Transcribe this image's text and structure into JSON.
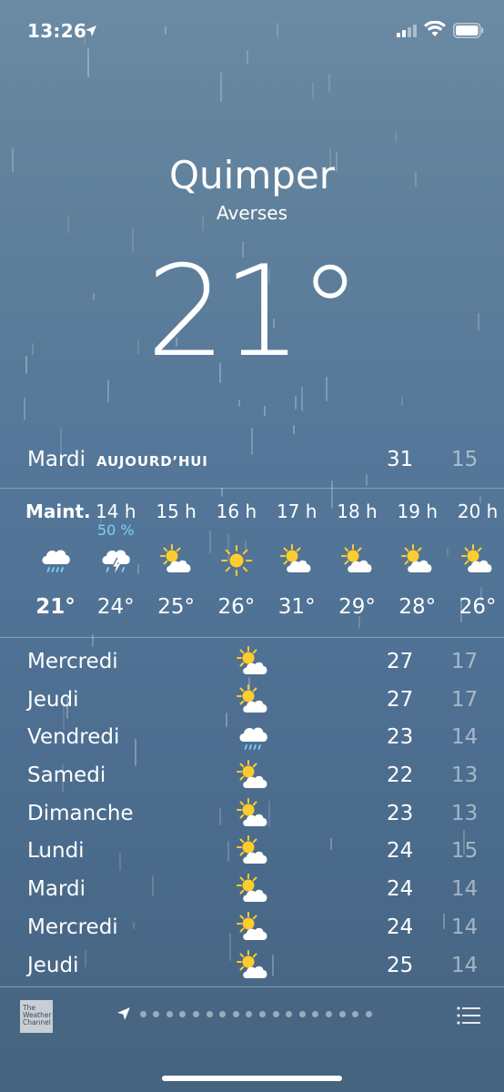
{
  "status_bar": {
    "time": "13:26"
  },
  "header": {
    "city": "Quimper",
    "condition": "Averses",
    "temperature": "21°"
  },
  "today": {
    "day": "Mardi",
    "tag": "AUJOURD’HUI",
    "high": "31",
    "low": "15"
  },
  "hourly": [
    {
      "hour": "Maint.",
      "precip": "",
      "icon": "rain-cloud-icon",
      "temp": "21°"
    },
    {
      "hour": "14 h",
      "precip": "50 %",
      "icon": "thunderstorm-icon",
      "temp": "24°"
    },
    {
      "hour": "15 h",
      "precip": "",
      "icon": "partly-sunny-icon",
      "temp": "25°"
    },
    {
      "hour": "16 h",
      "precip": "",
      "icon": "sun-icon",
      "temp": "26°"
    },
    {
      "hour": "17 h",
      "precip": "",
      "icon": "partly-sunny-icon",
      "temp": "31°"
    },
    {
      "hour": "18 h",
      "precip": "",
      "icon": "partly-sunny-icon",
      "temp": "29°"
    },
    {
      "hour": "19 h",
      "precip": "",
      "icon": "partly-sunny-icon",
      "temp": "28°"
    },
    {
      "hour": "20 h",
      "precip": "",
      "icon": "partly-sunny-icon",
      "temp": "26°"
    }
  ],
  "daily": [
    {
      "day": "Mercredi",
      "icon": "partly-sunny-icon",
      "high": "27",
      "low": "17"
    },
    {
      "day": "Jeudi",
      "icon": "partly-sunny-icon",
      "high": "27",
      "low": "17"
    },
    {
      "day": "Vendredi",
      "icon": "rain-cloud-icon",
      "high": "23",
      "low": "14"
    },
    {
      "day": "Samedi",
      "icon": "partly-sunny-icon",
      "high": "22",
      "low": "13"
    },
    {
      "day": "Dimanche",
      "icon": "partly-sunny-icon",
      "high": "23",
      "low": "13"
    },
    {
      "day": "Lundi",
      "icon": "partly-sunny-icon",
      "high": "24",
      "low": "15"
    },
    {
      "day": "Mardi",
      "icon": "partly-sunny-icon",
      "high": "24",
      "low": "14"
    },
    {
      "day": "Mercredi",
      "icon": "partly-sunny-icon",
      "high": "24",
      "low": "14"
    },
    {
      "day": "Jeudi",
      "icon": "partly-sunny-icon",
      "high": "25",
      "low": "14"
    }
  ],
  "bottom_bar": {
    "provider_logo": "The Weather Channel",
    "page_dots": 18
  },
  "colors": {
    "precip": "#7fd0f4",
    "sun": "#ffcc2e",
    "background_top": "#6b8aa3",
    "background_bottom": "#46647f"
  }
}
